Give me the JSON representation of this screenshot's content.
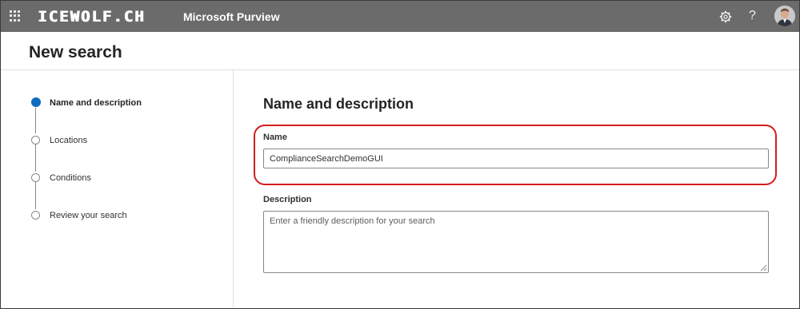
{
  "topbar": {
    "logo_text": "ICEWOLF.CH",
    "app_name": "Microsoft Purview",
    "icons": [
      "app-launcher-icon",
      "gear-icon",
      "help-icon",
      "avatar"
    ],
    "help_glyph": "?"
  },
  "page": {
    "title": "New search"
  },
  "steps": [
    {
      "label": "Name and description",
      "state": "current"
    },
    {
      "label": "Locations",
      "state": "pending"
    },
    {
      "label": "Conditions",
      "state": "pending"
    },
    {
      "label": "Review your search",
      "state": "pending"
    }
  ],
  "form": {
    "section_title": "Name and description",
    "name": {
      "label": "Name",
      "value": "ComplianceSearchDemoGUI"
    },
    "description": {
      "label": "Description",
      "value": "",
      "placeholder": "Enter a friendly description for your search"
    }
  },
  "colors": {
    "topbar_bg": "#6b6b6b",
    "accent_blue": "#0f6cbd",
    "highlight_red": "#d41c1c"
  }
}
